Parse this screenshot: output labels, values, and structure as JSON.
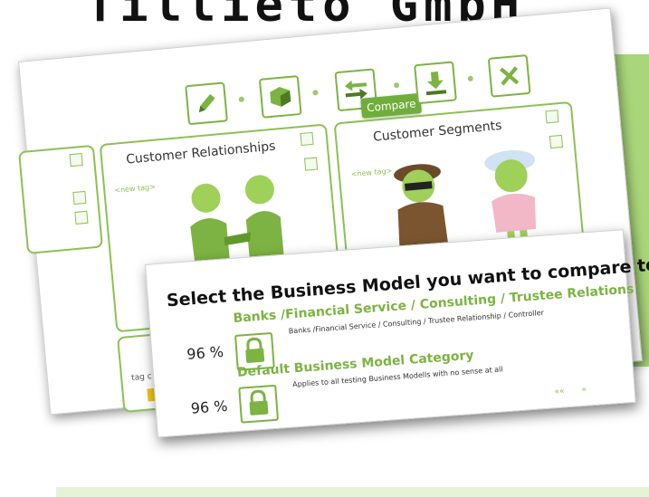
{
  "brand": "Tillieto GmbH",
  "back_card": {
    "tooltip": "Compare",
    "panels": [
      {
        "title": "Customer Relationships",
        "tag": "<new tag>"
      },
      {
        "title": "Customer Segments",
        "tag": "<new tag>"
      },
      {
        "tag": "tag c"
      }
    ],
    "toolbar_icons": [
      "pencil-icon",
      "cube-icon",
      "compare-arrows-icon",
      "download-icon",
      "close-icon"
    ]
  },
  "front_card": {
    "title": "Select the Business Model you want to compare to",
    "items": [
      {
        "percent": "96 %",
        "name": "Banks /Financial Service / Consulting / Trustee Relations",
        "description": "Banks /Financial Service / Consulting / Trustee Relationship / Controller"
      },
      {
        "percent": "96 %",
        "name": "Default Business Model Category",
        "description": "Applies to all testing Business Modells with no sense at all"
      }
    ],
    "pager_first": "««",
    "pager_prev": "«"
  },
  "colors": {
    "accent": "#7cb342",
    "accent_light": "#a9d67a"
  }
}
